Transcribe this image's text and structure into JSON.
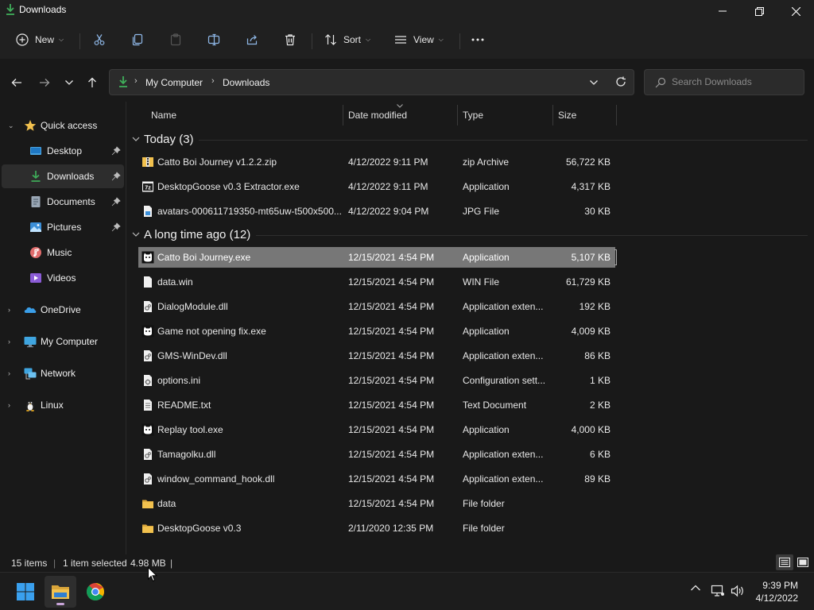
{
  "window": {
    "title": "Downloads"
  },
  "commandbar": {
    "new_label": "New",
    "sort_label": "Sort",
    "view_label": "View"
  },
  "address": {
    "crumbs": [
      "My Computer",
      "Downloads"
    ],
    "search_placeholder": "Search Downloads"
  },
  "sidebar": {
    "quick_access": "Quick access",
    "items": [
      {
        "label": "Desktop",
        "icon": "desktop-icon",
        "pinned": true
      },
      {
        "label": "Downloads",
        "icon": "download-icon",
        "pinned": true,
        "selected": true
      },
      {
        "label": "Documents",
        "icon": "documents-icon",
        "pinned": true
      },
      {
        "label": "Pictures",
        "icon": "pictures-icon",
        "pinned": true
      },
      {
        "label": "Music",
        "icon": "music-icon"
      },
      {
        "label": "Videos",
        "icon": "videos-icon"
      }
    ],
    "roots": [
      {
        "label": "OneDrive",
        "icon": "onedrive-icon"
      },
      {
        "label": "My Computer",
        "icon": "computer-icon"
      },
      {
        "label": "Network",
        "icon": "network-icon"
      },
      {
        "label": "Linux",
        "icon": "linux-icon"
      }
    ]
  },
  "columns": {
    "name": "Name",
    "date": "Date modified",
    "type": "Type",
    "size": "Size"
  },
  "groups": [
    {
      "title": "Today (3)",
      "files": [
        {
          "name": "Catto Boi Journey v1.2.2.zip",
          "date": "4/12/2022 9:11 PM",
          "type": "zip Archive",
          "size": "56,722 KB",
          "icon": "zip-icon"
        },
        {
          "name": "DesktopGoose v0.3 Extractor.exe",
          "date": "4/12/2022 9:11 PM",
          "type": "Application",
          "size": "4,317 KB",
          "icon": "7z-sfx-icon"
        },
        {
          "name": "avatars-000611719350-mt65uw-t500x500....",
          "date": "4/12/2022 9:04 PM",
          "type": "JPG File",
          "size": "30 KB",
          "icon": "image-file-icon"
        }
      ]
    },
    {
      "title": "A long time ago (12)",
      "files": [
        {
          "name": "Catto Boi Journey.exe",
          "date": "12/15/2021 4:54 PM",
          "type": "Application",
          "size": "5,107 KB",
          "icon": "cat-app-icon",
          "selected": true
        },
        {
          "name": "data.win",
          "date": "12/15/2021 4:54 PM",
          "type": "WIN File",
          "size": "61,729 KB",
          "icon": "blank-file-icon"
        },
        {
          "name": "DialogModule.dll",
          "date": "12/15/2021 4:54 PM",
          "type": "Application exten...",
          "size": "192 KB",
          "icon": "dll-file-icon"
        },
        {
          "name": "Game not opening fix.exe",
          "date": "12/15/2021 4:54 PM",
          "type": "Application",
          "size": "4,009 KB",
          "icon": "cat-app-icon"
        },
        {
          "name": "GMS-WinDev.dll",
          "date": "12/15/2021 4:54 PM",
          "type": "Application exten...",
          "size": "86 KB",
          "icon": "dll-file-icon"
        },
        {
          "name": "options.ini",
          "date": "12/15/2021 4:54 PM",
          "type": "Configuration sett...",
          "size": "1 KB",
          "icon": "ini-file-icon"
        },
        {
          "name": "README.txt",
          "date": "12/15/2021 4:54 PM",
          "type": "Text Document",
          "size": "2 KB",
          "icon": "text-file-icon"
        },
        {
          "name": "Replay tool.exe",
          "date": "12/15/2021 4:54 PM",
          "type": "Application",
          "size": "4,000 KB",
          "icon": "cat-app-icon"
        },
        {
          "name": "Tamagolku.dll",
          "date": "12/15/2021 4:54 PM",
          "type": "Application exten...",
          "size": "6 KB",
          "icon": "dll-file-icon"
        },
        {
          "name": "window_command_hook.dll",
          "date": "12/15/2021 4:54 PM",
          "type": "Application exten...",
          "size": "89 KB",
          "icon": "dll-file-icon"
        },
        {
          "name": "data",
          "date": "12/15/2021 4:54 PM",
          "type": "File folder",
          "size": "",
          "icon": "folder-icon"
        },
        {
          "name": "DesktopGoose v0.3",
          "date": "2/11/2020 12:35 PM",
          "type": "File folder",
          "size": "",
          "icon": "folder-icon"
        }
      ]
    }
  ],
  "status": {
    "items": "15 items",
    "selected": "1 item selected",
    "size": "4.98 MB"
  },
  "clock": {
    "time": "9:39 PM",
    "date": "4/12/2022"
  },
  "colors": {
    "accent_green": "#3fae5a",
    "folder_yellow": "#f2c14e",
    "selected_row": "#777777"
  }
}
